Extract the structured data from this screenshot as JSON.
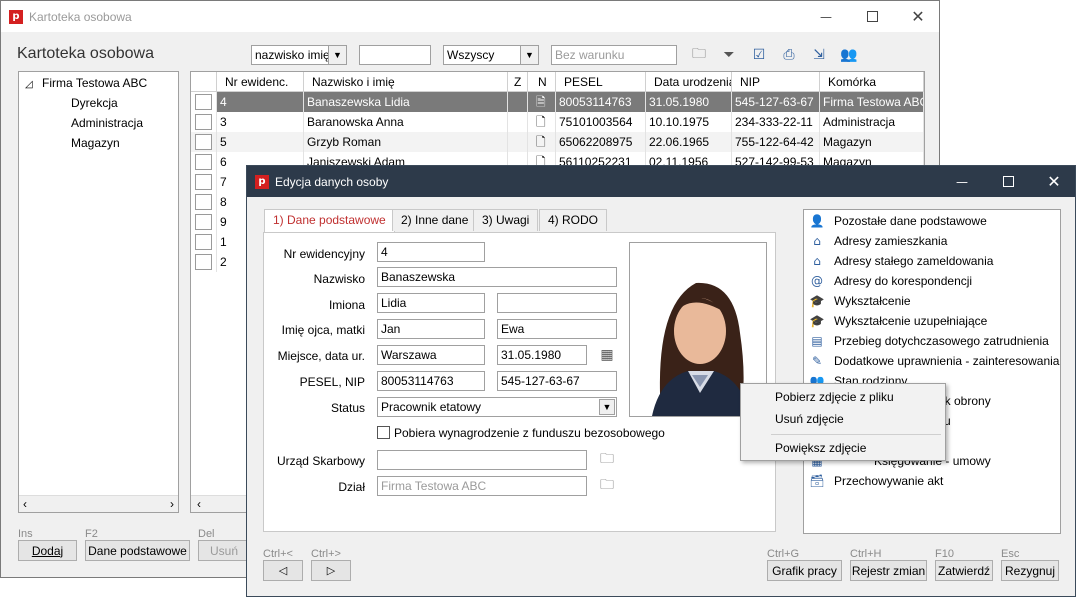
{
  "back_window": {
    "title": "Kartoteka osobowa",
    "heading": "Kartoteka osobowa",
    "filter_sort": "nazwisko imię",
    "filter_text": "",
    "filter_scope": "Wszyscy",
    "condition_placeholder": "Bez warunku",
    "tree": {
      "root": "Firma Testowa ABC",
      "children": [
        "Dyrekcja",
        "Administracja",
        "Magazyn"
      ]
    },
    "grid": {
      "headers": [
        "Nr ewidenc.",
        "Nazwisko i imię",
        "Z",
        "N",
        "PESEL",
        "Data urodzenia",
        "NIP",
        "Komórka"
      ],
      "rows": [
        {
          "nr": "4",
          "name": "Banaszewska Lidia",
          "pesel": "80053114763",
          "date": "31.05.1980",
          "nip": "545-127-63-67",
          "unit": "Firma Testowa ABC"
        },
        {
          "nr": "3",
          "name": "Baranowska Anna",
          "pesel": "75101003564",
          "date": "10.10.1975",
          "nip": "234-333-22-11",
          "unit": "Administracja"
        },
        {
          "nr": "5",
          "name": "Grzyb Roman",
          "pesel": "65062208975",
          "date": "22.06.1965",
          "nip": "755-122-64-42",
          "unit": "Magazyn"
        },
        {
          "nr": "6",
          "name": "Janiszewski Adam",
          "pesel": "56110252231",
          "date": "02.11.1956",
          "nip": "527-142-99-53",
          "unit": "Magazyn"
        },
        {
          "nr": "7"
        },
        {
          "nr": "8"
        },
        {
          "nr": "9"
        },
        {
          "nr": "1"
        },
        {
          "nr": "2"
        }
      ]
    },
    "bottom": {
      "ins": "Ins",
      "f2": "F2",
      "del": "Del",
      "add": "Dodaj",
      "basic": "Dane podstawowe",
      "remove": "Usuń"
    }
  },
  "dialog": {
    "title": "Edycja danych osoby",
    "tabs": [
      "1) Dane podstawowe",
      "2) Inne dane",
      "3) Uwagi",
      "4) RODO"
    ],
    "labels": {
      "nr": "Nr ewidencyjny",
      "surname": "Nazwisko",
      "names": "Imiona",
      "parents": "Imię ojca, matki",
      "birth": "Miejsce, data ur.",
      "ids": "PESEL, NIP",
      "status": "Status",
      "tax": "Urząd Skarbowy",
      "dept": "Dział"
    },
    "values": {
      "nr": "4",
      "surname": "Banaszewska",
      "first_name": "Lidia",
      "second_name": "",
      "father": "Jan",
      "mother": "Ewa",
      "birth_place": "Warszawa",
      "birth_date": "31.05.1980",
      "pesel": "80053114763",
      "nip": "545-127-63-67",
      "status": "Pracownik etatowy",
      "tax_office": "",
      "dept": "Firma Testowa ABC"
    },
    "checkbox_label": "Pobiera wynagrodzenie z funduszu bezosobowego",
    "right_list": [
      "Pozostałe dane podstawowe",
      "Adresy zamieszkania",
      "Adresy stałego zameldowania",
      "Adresy do korespondencji",
      "Wykształcenie",
      "Wykształcenie uzupełniające",
      "Przebieg dotychczasowego zatrudnienia",
      "Dodatkowe uprawnienia - zainteresowania",
      "Stan rodzinny",
      "ek obrony",
      "ku",
      "",
      "Księgowanie - umowy",
      "Przechowywanie akt"
    ],
    "context_menu": [
      "Pobierz zdjęcie z pliku",
      "Usuń zdjęcie",
      "Powiększ zdjęcie"
    ],
    "nav": {
      "prev_key": "Ctrl+<",
      "next_key": "Ctrl+>"
    },
    "buttons": [
      {
        "key": "Ctrl+G",
        "label": "Grafik pracy"
      },
      {
        "key": "Ctrl+H",
        "label": "Rejestr zmian"
      },
      {
        "key": "F10",
        "label": "Zatwierdź"
      },
      {
        "key": "Esc",
        "label": "Rezygnuj"
      }
    ]
  }
}
